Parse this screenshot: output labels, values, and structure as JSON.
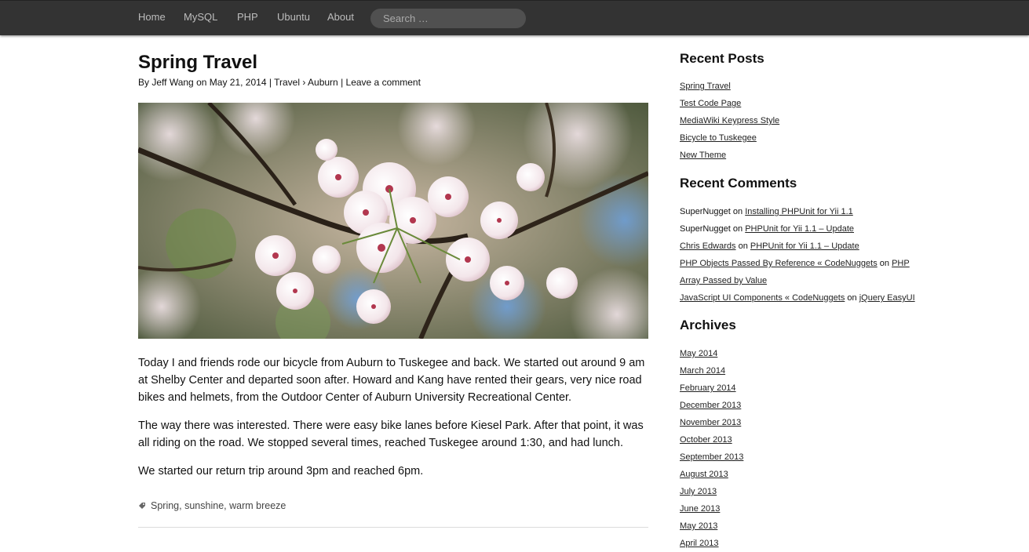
{
  "nav": {
    "items": [
      "Home",
      "MySQL",
      "PHP",
      "Ubuntu",
      "About"
    ],
    "search_placeholder": "Search …"
  },
  "post": {
    "title": "Spring Travel",
    "meta": {
      "by": "By",
      "author": "Jeff Wang",
      "on": "on",
      "date": "May 21, 2014",
      "sep1": "|",
      "category": "Travel",
      "arrow": "›",
      "subcategory": "Auburn",
      "sep2": "|",
      "comment_link": "Leave a comment"
    },
    "paragraphs": [
      "Today I and friends rode our bicycle from Auburn to Tuskegee and back. We started out around 9 am at Shelby Center and departed soon after. Howard and Kang have rented their gears, very nice road bikes and helmets, from the Outdoor Center of Auburn University Recreational Center.",
      "The way there was interested. There were easy bike lanes before Kiesel Park. After that point, it was all riding on the road. We stopped several times, reached Tuskegee around 1:30, and had lunch.",
      "We started our return trip around 3pm and reached 6pm."
    ],
    "tags": [
      "Spring",
      "sunshine",
      "warm breeze"
    ],
    "tag_separator": ","
  },
  "sidebar": {
    "recent_posts_title": "Recent Posts",
    "recent_posts": [
      "Spring Travel",
      "Test Code Page",
      "MediaWiki Keypress Style",
      "Bicycle to Tuskegee",
      "New Theme"
    ],
    "recent_comments_title": "Recent Comments",
    "comment_on": "on",
    "recent_comments": [
      {
        "author": "SuperNugget",
        "author_link": false,
        "post": "Installing PHPUnit for Yii 1.1",
        "post_cont": ""
      },
      {
        "author": "SuperNugget",
        "author_link": false,
        "post": "PHPUnit for Yii 1.1 – Update",
        "post_cont": ""
      },
      {
        "author": "Chris Edwards",
        "author_link": true,
        "post": "PHPUnit for Yii 1.1 – Update",
        "post_cont": ""
      },
      {
        "author": "PHP Objects Passed By Reference « CodeNuggets",
        "author_link": true,
        "post": "PHP",
        "post_cont": "Array Passed by Value"
      },
      {
        "author": "JavaScript UI Components « CodeNuggets",
        "author_link": true,
        "post": "jQuery EasyUI",
        "post_cont": ""
      }
    ],
    "archives_title": "Archives",
    "archives": [
      "May 2014",
      "March 2014",
      "February 2014",
      "December 2013",
      "November 2013",
      "October 2013",
      "September 2013",
      "August 2013",
      "July 2013",
      "June 2013",
      "May 2013",
      "April 2013"
    ]
  }
}
